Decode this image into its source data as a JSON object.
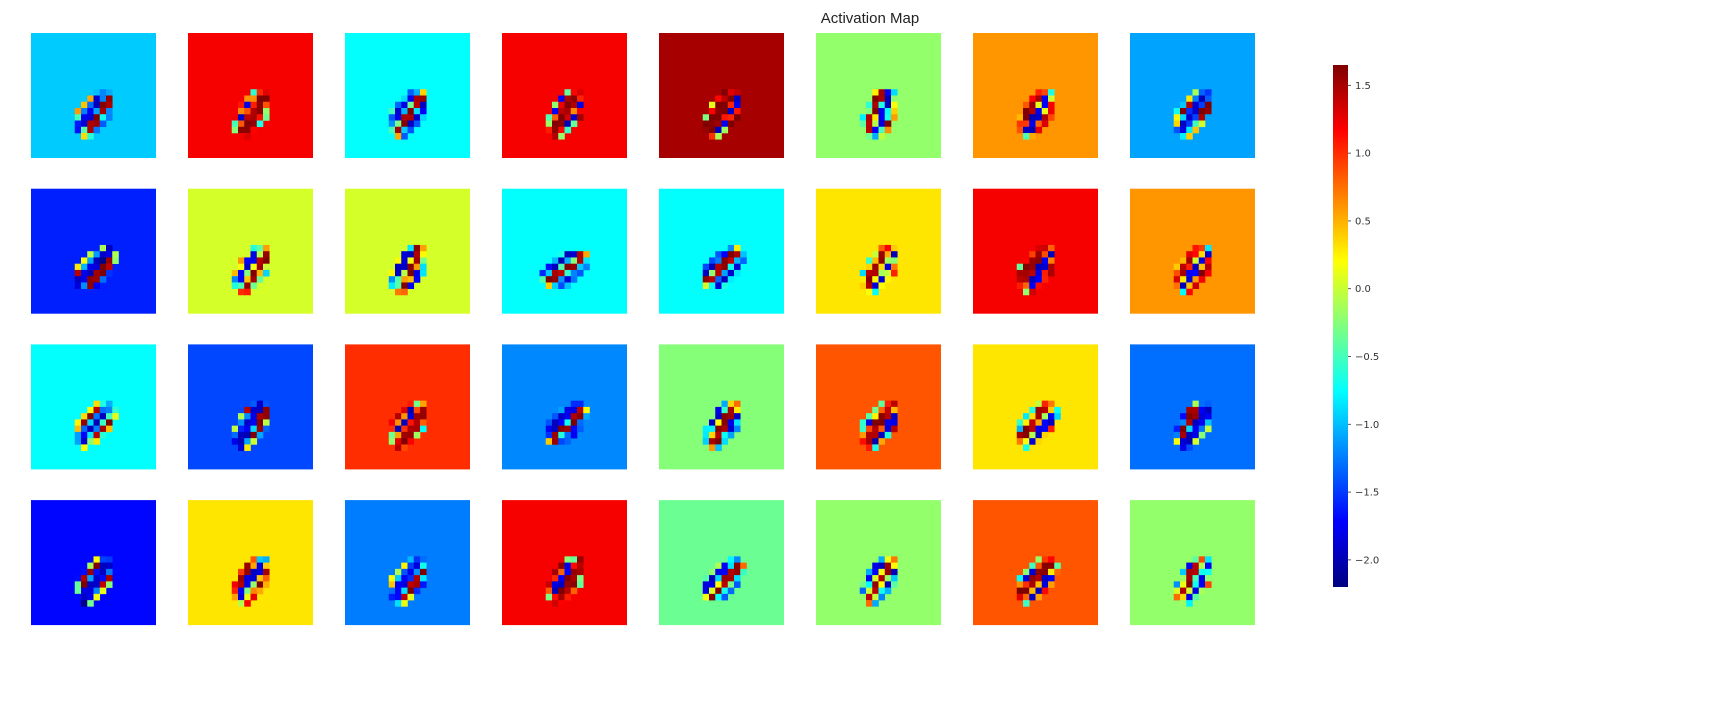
{
  "chart_data": {
    "type": "heatmap",
    "title": "Activation Map",
    "layout": "4 rows x 8 columns of activation maps",
    "colormap": "jet",
    "colormap_stops": [
      "#00007f",
      "#0000ff",
      "#007fff",
      "#00ffff",
      "#7fff7f",
      "#ffff00",
      "#ff7f00",
      "#ff0000",
      "#7f0000"
    ],
    "grid": false,
    "colorbar": {
      "position": "right",
      "vmin": -2.2,
      "vmax": 1.65,
      "ticks": [
        1.5,
        1.0,
        0.5,
        0.0,
        -0.5,
        -1.0,
        -1.5,
        -2.0
      ],
      "tick_labels": [
        "1.5",
        "1.0",
        "0.5",
        "0.0",
        "−0.5",
        "−1.0",
        "−1.5",
        "−2.0"
      ]
    },
    "maps": [
      {
        "background_value": -0.95,
        "angle": -55
      },
      {
        "background_value": 1.2,
        "angle": -60
      },
      {
        "background_value": -0.75,
        "angle": -55
      },
      {
        "background_value": 1.2,
        "angle": -60
      },
      {
        "background_value": 1.5,
        "angle": -60
      },
      {
        "background_value": -0.2,
        "angle": -70
      },
      {
        "background_value": 0.6,
        "angle": -60
      },
      {
        "background_value": -1.1,
        "angle": -55
      },
      {
        "background_value": -1.6,
        "angle": -45
      },
      {
        "background_value": 0.05,
        "angle": -60
      },
      {
        "background_value": 0.05,
        "angle": -65
      },
      {
        "background_value": -0.75,
        "angle": -35
      },
      {
        "background_value": -0.75,
        "angle": -45
      },
      {
        "background_value": 0.3,
        "angle": -60
      },
      {
        "background_value": 1.2,
        "angle": -55
      },
      {
        "background_value": 0.6,
        "angle": -55
      },
      {
        "background_value": -0.75,
        "angle": -50
      },
      {
        "background_value": -1.45,
        "angle": -60
      },
      {
        "background_value": 1.0,
        "angle": -55
      },
      {
        "background_value": -1.2,
        "angle": -45
      },
      {
        "background_value": -0.25,
        "angle": -60
      },
      {
        "background_value": 0.85,
        "angle": -55
      },
      {
        "background_value": 0.3,
        "angle": -50
      },
      {
        "background_value": -1.3,
        "angle": -60
      },
      {
        "background_value": -1.7,
        "angle": -55
      },
      {
        "background_value": 0.3,
        "angle": -60
      },
      {
        "background_value": -1.25,
        "angle": -55
      },
      {
        "background_value": 1.2,
        "angle": -60
      },
      {
        "background_value": -0.35,
        "angle": -45
      },
      {
        "background_value": -0.2,
        "angle": -60
      },
      {
        "background_value": 0.85,
        "angle": -50
      },
      {
        "background_value": -0.2,
        "angle": -60
      }
    ]
  }
}
